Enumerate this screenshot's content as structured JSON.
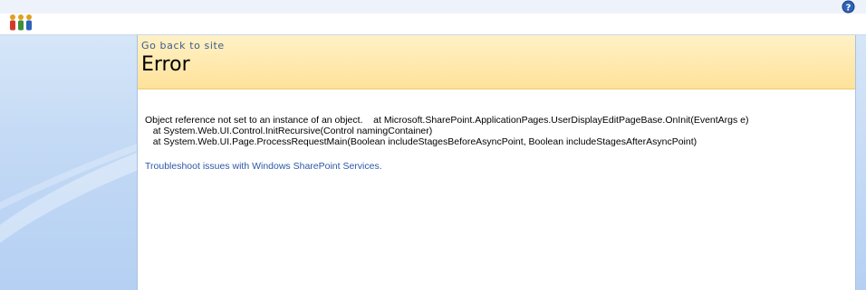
{
  "header": {
    "logo_icon": "people-logo-icon",
    "help_icon": "help-icon"
  },
  "title_area": {
    "go_back_label": "Go back to site",
    "page_title": "Error"
  },
  "error": {
    "lines": [
      "Object reference not set to an instance of an object.    at Microsoft.SharePoint.ApplicationPages.UserDisplayEditPageBase.OnInit(EventArgs e)",
      "   at System.Web.UI.Control.InitRecursive(Control namingContainer)",
      "   at System.Web.UI.Page.ProcessRequestMain(Boolean includeStagesBeforeAsyncPoint, Boolean includeStagesAfterAsyncPoint)"
    ],
    "troubleshoot_link": "Troubleshoot issues with Windows SharePoint Services."
  },
  "colors": {
    "title_bg": "#ffe29a",
    "nav_bg": "#c4daf5",
    "link": "#2c56a8"
  }
}
